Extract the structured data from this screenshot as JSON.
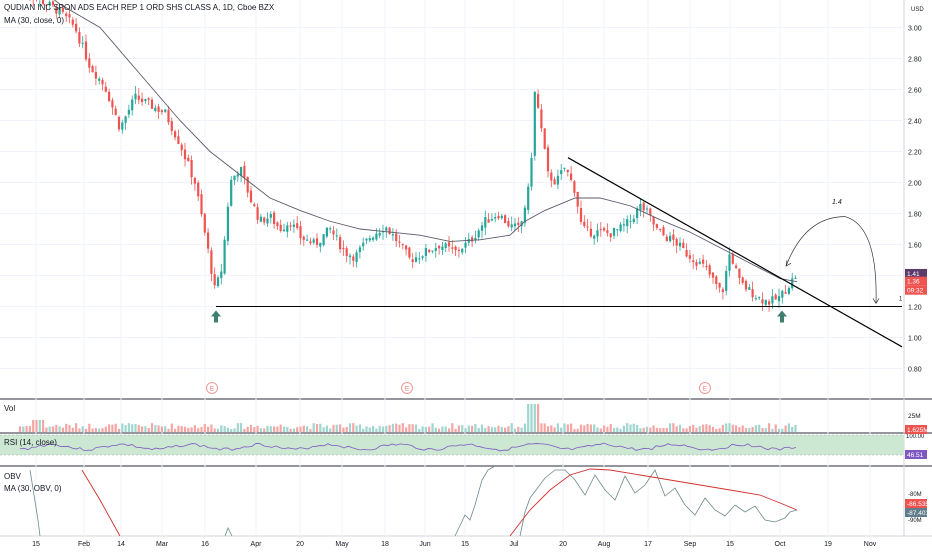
{
  "header": {
    "symbol_title": "QUDIAN INC SPON ADS EACH REP 1 ORD SHS CLASS A, 1D, Cboe BZX",
    "ma_label": "MA (30, close, 0)"
  },
  "colors": {
    "up": "#26a69a",
    "down": "#ef5350",
    "ma_line": "#5b5b6b",
    "rsi_line": "#7e57c2",
    "rsi_band": "#cde8d2",
    "obv_line": "#6d8a8a",
    "obv_ma": "#d32f2f",
    "trendline": "#000000",
    "arrow": "#3f7f6f"
  },
  "price_panel": {
    "currency": "USD",
    "ticks": [
      "3.00",
      "2.80",
      "2.60",
      "2.40",
      "2.20",
      "2.00",
      "1.80",
      "1.60",
      "1.40",
      "1.20",
      "1.00",
      "0.80"
    ],
    "last_price": "1.41",
    "ma_value": "1.36",
    "countdown": "09:32",
    "annotation": "1.4",
    "earnings_marker": "E",
    "right_edge_label": "1"
  },
  "volume_panel": {
    "title": "Vol",
    "tick": "25M",
    "value_badge": "1.625M"
  },
  "rsi_panel": {
    "title": "RSI (14, close)",
    "tick": "100.00",
    "value_badge": "46.51"
  },
  "obv_panel": {
    "title": "OBV",
    "ma_label": "MA (30, OBV, 0)",
    "ticks": [
      "-80M",
      "-90M"
    ],
    "obv_badge": "-87.401M",
    "ma_badge": "-86.535M"
  },
  "x_axis": {
    "labels": [
      "15",
      "Feb",
      "14",
      "Mar",
      "16",
      "Apr",
      "20",
      "May",
      "18",
      "Jun",
      "15",
      "Jul",
      "20",
      "Aug",
      "17",
      "Sep",
      "15",
      "Oct",
      "19",
      "Nov"
    ]
  },
  "chart_data": {
    "type": "candlestick",
    "title": "QUDIAN INC SPON ADS EACH REP 1 ORD SHS CLASS A, 1D, Cboe BZX",
    "ylim": [
      0.7,
      3.1
    ],
    "y_unit": "USD",
    "series": [
      {
        "name": "MA (30, close, 0)",
        "type": "line",
        "points": [
          [
            "15",
            3.25
          ],
          [
            "Feb",
            3.0
          ],
          [
            "14",
            2.7
          ],
          [
            "Mar",
            2.45
          ],
          [
            "16",
            2.1
          ],
          [
            "Apr",
            1.95
          ],
          [
            "20",
            1.82
          ],
          [
            "May",
            1.74
          ],
          [
            "18",
            1.7
          ],
          [
            "Jun",
            1.67
          ],
          [
            "15",
            1.62
          ],
          [
            "Jul",
            1.66
          ],
          [
            "20",
            1.9
          ],
          [
            "Aug",
            1.86
          ],
          [
            "17",
            1.72
          ],
          [
            "Sep",
            1.58
          ],
          [
            "15",
            1.52
          ],
          [
            "Oct",
            1.38
          ]
        ]
      },
      {
        "name": "Trendline",
        "type": "line",
        "points": [
          [
            "20",
            2.16
          ],
          [
            "Nov",
            1.08
          ]
        ]
      },
      {
        "name": "Support",
        "type": "line",
        "points": [
          [
            "16",
            1.2
          ],
          [
            "Nov",
            1.2
          ]
        ]
      }
    ],
    "candles_approx": [
      [
        "15",
        3.2,
        3.1
      ],
      [
        "Feb",
        2.95,
        2.9
      ],
      [
        "14",
        2.3,
        2.2
      ],
      [
        "Mar",
        2.55,
        2.45
      ],
      [
        "16",
        1.5,
        1.25
      ],
      [
        "Apr",
        1.9,
        2.0
      ],
      [
        "20",
        1.65,
        1.7
      ],
      [
        "May",
        1.55,
        1.5
      ],
      [
        "18",
        1.65,
        1.62
      ],
      [
        "Jun",
        1.6,
        1.55
      ],
      [
        "15",
        1.62,
        1.75
      ],
      [
        "Jul",
        1.7,
        2.6
      ],
      [
        "20",
        2.1,
        2.0
      ],
      [
        "Aug",
        1.7,
        1.68
      ],
      [
        "17",
        1.85,
        1.75
      ],
      [
        "Sep",
        1.5,
        1.45
      ],
      [
        "15",
        1.45,
        1.3
      ],
      [
        "Oct",
        1.25,
        1.41
      ]
    ],
    "last_close": 1.41,
    "legend": "top-left",
    "grid": true
  }
}
